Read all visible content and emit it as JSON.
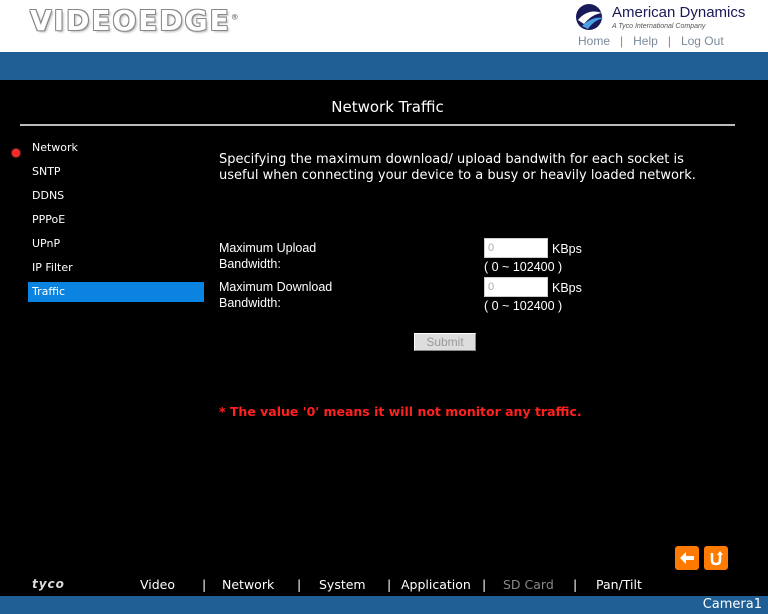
{
  "header": {
    "logo_text": "VIDEOEDGE",
    "logo_mark": "®",
    "brand_name": "American Dynamics",
    "brand_sub": "A Tyco International Company",
    "links": {
      "home": "Home",
      "help": "Help",
      "logout": "Log Out",
      "sep": "|"
    }
  },
  "page_title": "Network Traffic",
  "sidebar": {
    "items": [
      {
        "label": "Network"
      },
      {
        "label": "SNTP"
      },
      {
        "label": "DDNS"
      },
      {
        "label": "PPPoE"
      },
      {
        "label": "UPnP"
      },
      {
        "label": "IP Filter"
      },
      {
        "label": "Traffic",
        "active": true
      }
    ]
  },
  "main": {
    "description": "Specifying the maximum download/ upload bandwith for each socket is useful when connecting your device to a busy or heavily loaded network.",
    "upload": {
      "label_line1": "Maximum Upload",
      "label_line2": "Bandwidth:",
      "value": "0",
      "unit": "KBps",
      "range": "( 0 ~ 102400 )"
    },
    "download": {
      "label_line1": "Maximum Download",
      "label_line2": "Bandwidth:",
      "value": "0",
      "unit": "KBps",
      "range": "( 0 ~ 102400 )"
    },
    "submit_label": "Submit",
    "note": "* The value '0' means it will not monitor any traffic."
  },
  "bottom_menu": {
    "tyco": "tyco",
    "items": [
      "Video",
      "Network",
      "System",
      "Application",
      "SD Card",
      "Pan/Tilt"
    ],
    "sep": "|"
  },
  "status": {
    "camera": "Camera1"
  },
  "colors": {
    "accent_blue": "#1f5f95",
    "active_item": "#0a84e0",
    "note_red": "#ff2020",
    "nav_orange": "#ff7a00"
  },
  "icons": {
    "back": "arrow-left-icon",
    "refresh": "u-turn-icon"
  }
}
